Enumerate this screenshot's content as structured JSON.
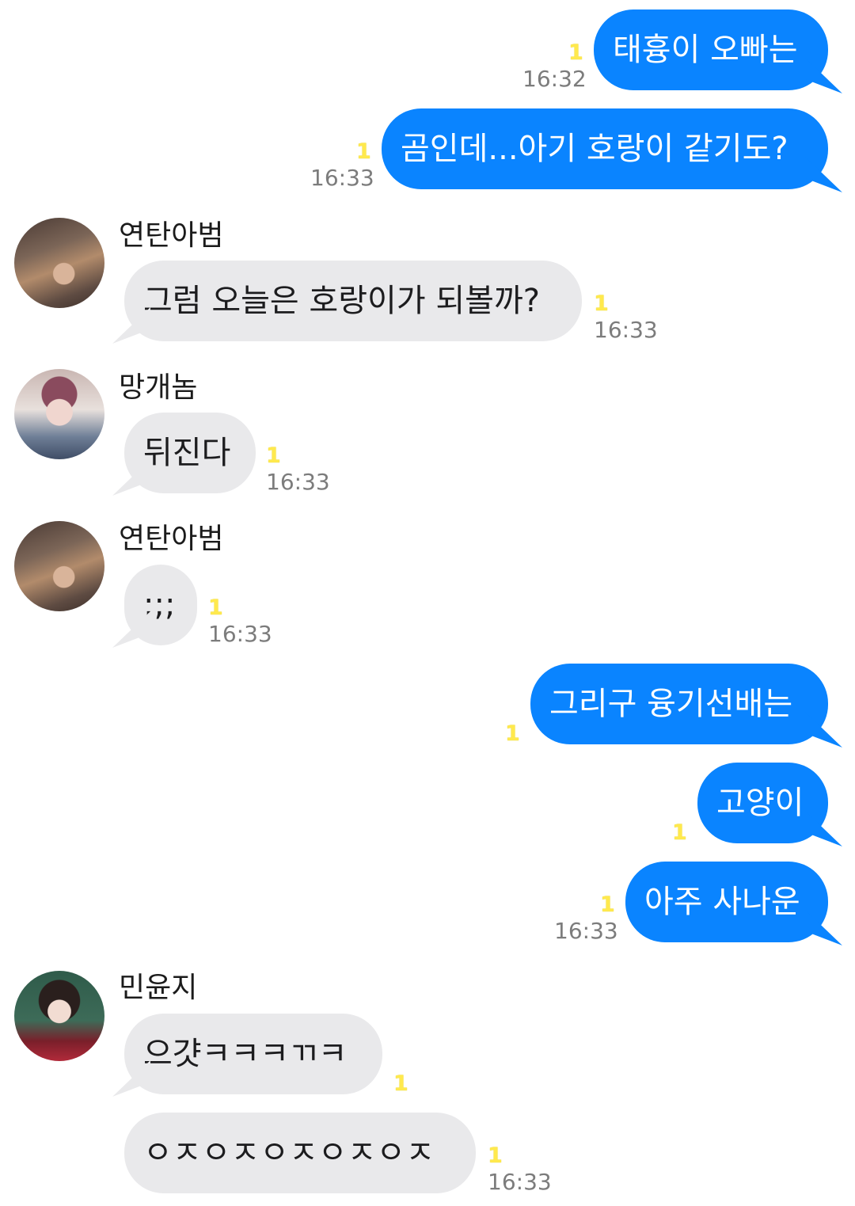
{
  "read_marker": "1",
  "messages": [
    {
      "type": "out",
      "text": "태흉이 오빠는",
      "time": "16:32"
    },
    {
      "type": "out",
      "text": "곰인데...아기 호랑이 같기도?",
      "time": "16:33"
    },
    {
      "type": "in",
      "sender": "연탄아범",
      "text": "그럼 오늘은 호랑이가 되볼까?",
      "time": "16:33"
    },
    {
      "type": "in",
      "sender": "망개놈",
      "text": "뒤진다",
      "time": "16:33"
    },
    {
      "type": "in",
      "sender": "연탄아범",
      "text": ";;;",
      "time": "16:33"
    },
    {
      "type": "out",
      "text": "그리구 융기선배는"
    },
    {
      "type": "out",
      "text": "고양이"
    },
    {
      "type": "out",
      "text": "아주 사나운",
      "time": "16:33"
    },
    {
      "type": "in",
      "sender": "민윤지",
      "text": "으걋ㅋㅋㅋㄲㅋ"
    },
    {
      "type": "in",
      "text": "ㅇㅈㅇㅈㅇㅈㅇㅈㅇㅈ",
      "time": "16:33"
    }
  ],
  "colors": {
    "outgoing_bubble": "#0a84ff",
    "incoming_bubble": "#e9e9eb",
    "read_marker": "#ffe94d"
  }
}
